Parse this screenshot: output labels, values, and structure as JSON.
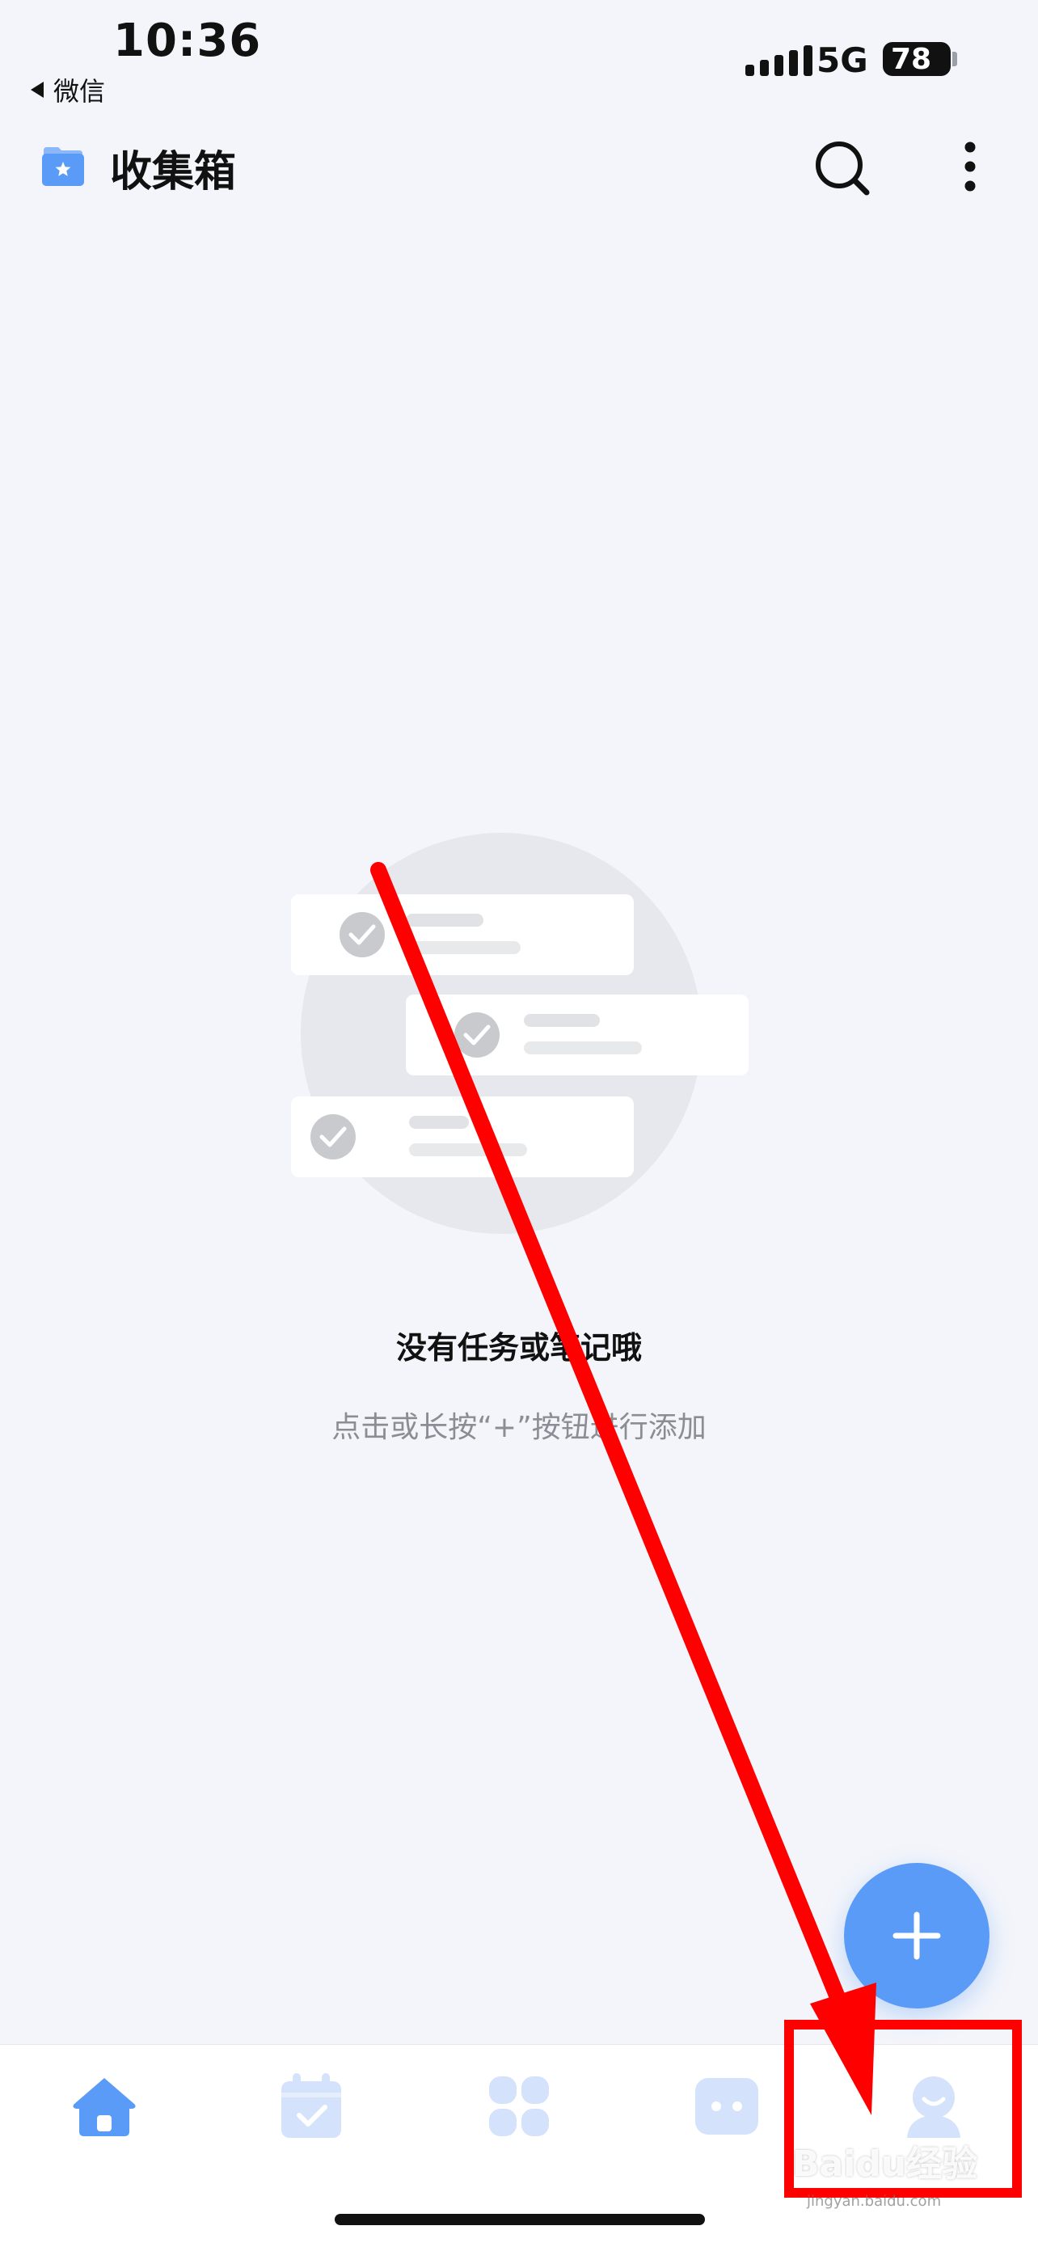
{
  "status_bar": {
    "time": "10:36",
    "back_app": "微信",
    "network": "5G",
    "battery": "78"
  },
  "header": {
    "title": "收集箱",
    "folder_icon": "inbox-folder-star-icon",
    "search_icon": "search-icon",
    "more_icon": "more-vertical-icon"
  },
  "empty_state": {
    "title": "没有任务或笔记哦",
    "subtitle": "点击或长按“+”按钮进行添加"
  },
  "fab": {
    "icon": "plus-icon"
  },
  "tab_bar": {
    "tabs": [
      {
        "icon": "home-icon",
        "active": true
      },
      {
        "icon": "calendar-check-icon",
        "active": false
      },
      {
        "icon": "apps-grid-icon",
        "active": false
      },
      {
        "icon": "chat-bubble-icon",
        "active": false
      },
      {
        "icon": "profile-icon",
        "active": false
      }
    ]
  },
  "watermark": {
    "text": "Baidu经验",
    "url": "jingyan.baidu.com"
  },
  "colors": {
    "accent": "#5a9bf7",
    "tab_inactive": "#d4e3fb",
    "background": "#f3f5fa",
    "annotation": "#ff0000"
  }
}
